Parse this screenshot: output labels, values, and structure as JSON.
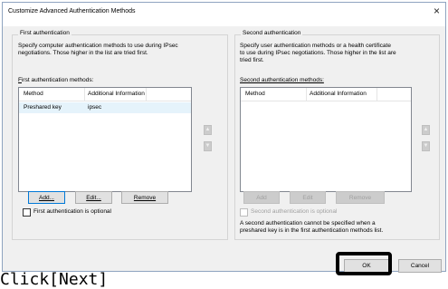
{
  "dialog": {
    "title": "Customize Advanced Authentication Methods",
    "close_glyph": "×"
  },
  "first": {
    "group_title": "First authentication",
    "description_1": "Specify computer authentication methods to use during IPsec",
    "description_2": "negotiations.  Those higher in the list are tried first.",
    "methods_label": "First authentication methods:",
    "methods_label_accel": "F",
    "methods_label_rest": "irst authentication methods:",
    "columns": [
      "Method",
      "Additional Information"
    ],
    "rows": [
      {
        "method": "Preshared key",
        "info": "ipsec"
      }
    ],
    "add_label": "Add...",
    "edit_label": "Edit...",
    "remove_label": "Remove",
    "optional_label": "First authentication is optional",
    "optional_checked": false
  },
  "second": {
    "group_title": "Second authentication",
    "description_1": "Specify user authentication methods or a health certificate",
    "description_2": "to use during IPsec negotiations.  Those higher in the list are",
    "description_3": "tried first.",
    "methods_label": "Second authentication methods:",
    "columns": [
      "Method",
      "Additional Information"
    ],
    "rows": [],
    "add_label": "Add",
    "edit_label": "Edit",
    "remove_label": "Remove",
    "optional_label": "Second authentication is optional",
    "note_1": "A second authentication cannot be specified when a",
    "note_2": "preshared key is in the first authentication methods list."
  },
  "footer": {
    "ok_label": "OK",
    "cancel_label": "Cancel"
  },
  "caption": "Click[Next]",
  "icons": {
    "up": "move-up-icon",
    "down": "move-down-icon",
    "close": "close-icon"
  }
}
